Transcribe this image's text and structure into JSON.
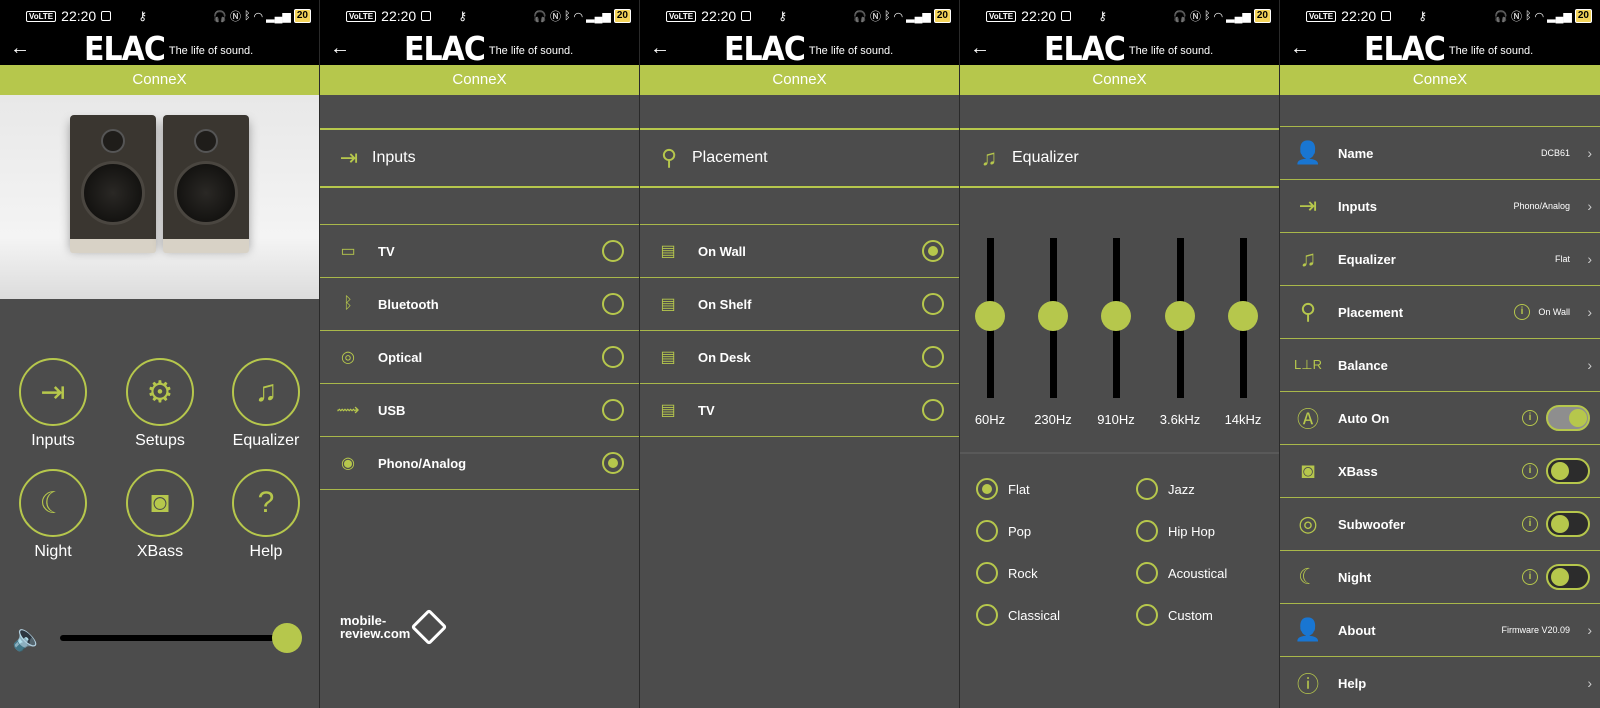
{
  "status": {
    "volte": "VoLTE",
    "time": "22:20",
    "battery": "20"
  },
  "header": {
    "back": "←",
    "brand": "ELAC",
    "tagline": "The life of sound.",
    "title": "ConneX"
  },
  "home": {
    "items": [
      {
        "label": "Inputs",
        "icon": "input-icon"
      },
      {
        "label": "Setups",
        "icon": "setup-gear-icon"
      },
      {
        "label": "Equalizer",
        "icon": "equalizer-icon"
      },
      {
        "label": "Night",
        "icon": "moon-icon"
      },
      {
        "label": "XBass",
        "icon": "speaker-icon"
      },
      {
        "label": "Help",
        "icon": "help-icon"
      }
    ],
    "volume": 1.0
  },
  "inputs": {
    "title": "Inputs",
    "items": [
      {
        "label": "TV",
        "icon": "hdmi-icon",
        "selected": false
      },
      {
        "label": "Bluetooth",
        "icon": "bluetooth-icon",
        "selected": false
      },
      {
        "label": "Optical",
        "icon": "optical-icon",
        "selected": false
      },
      {
        "label": "USB",
        "icon": "usb-icon",
        "selected": false
      },
      {
        "label": "Phono/Analog",
        "icon": "turntable-icon",
        "selected": true
      }
    ],
    "watermark": {
      "line1": "mobile-",
      "line2": "review.com"
    }
  },
  "placement": {
    "title": "Placement",
    "items": [
      {
        "label": "On Wall",
        "selected": true
      },
      {
        "label": "On Shelf",
        "selected": false
      },
      {
        "label": "On Desk",
        "selected": false
      },
      {
        "label": "TV",
        "selected": false
      }
    ]
  },
  "equalizer": {
    "title": "Equalizer",
    "bands": [
      {
        "freq": "60Hz",
        "level": 0
      },
      {
        "freq": "230Hz",
        "level": 0
      },
      {
        "freq": "910Hz",
        "level": 0
      },
      {
        "freq": "3.6kHz",
        "level": 0
      },
      {
        "freq": "14kHz",
        "level": 0
      }
    ],
    "presets": [
      {
        "label": "Flat",
        "selected": true
      },
      {
        "label": "Jazz",
        "selected": false
      },
      {
        "label": "Pop",
        "selected": false
      },
      {
        "label": "Hip Hop",
        "selected": false
      },
      {
        "label": "Rock",
        "selected": false
      },
      {
        "label": "Acoustical",
        "selected": false
      },
      {
        "label": "Classical",
        "selected": false
      },
      {
        "label": "Custom",
        "selected": false
      }
    ]
  },
  "settings": {
    "rows": [
      {
        "label": "Name",
        "value": "DCB61",
        "type": "link",
        "icon": "person-icon"
      },
      {
        "label": "Inputs",
        "value": "Phono/Analog",
        "type": "link",
        "icon": "input-icon"
      },
      {
        "label": "Equalizer",
        "value": "Flat",
        "type": "link",
        "icon": "equalizer-icon"
      },
      {
        "label": "Placement",
        "value": "On Wall",
        "type": "link-info",
        "icon": "location-pin-icon"
      },
      {
        "label": "Balance",
        "value": "",
        "type": "link",
        "icon": "balance-icon"
      },
      {
        "label": "Auto On",
        "value": "",
        "type": "toggle",
        "on": true,
        "icon": "auto-on-icon"
      },
      {
        "label": "XBass",
        "value": "",
        "type": "toggle",
        "on": false,
        "icon": "speaker-icon"
      },
      {
        "label": "Subwoofer",
        "value": "",
        "type": "toggle",
        "on": false,
        "icon": "subwoofer-icon"
      },
      {
        "label": "Night",
        "value": "",
        "type": "toggle",
        "on": false,
        "icon": "moon-icon"
      },
      {
        "label": "About",
        "value": "Firmware V20.09",
        "type": "link",
        "icon": "about-person-icon"
      },
      {
        "label": "Help",
        "value": "",
        "type": "link",
        "icon": "help-icon"
      }
    ]
  },
  "colors": {
    "accent": "#b6c74c",
    "panel": "#4c4c4c",
    "bar": "#000000"
  }
}
